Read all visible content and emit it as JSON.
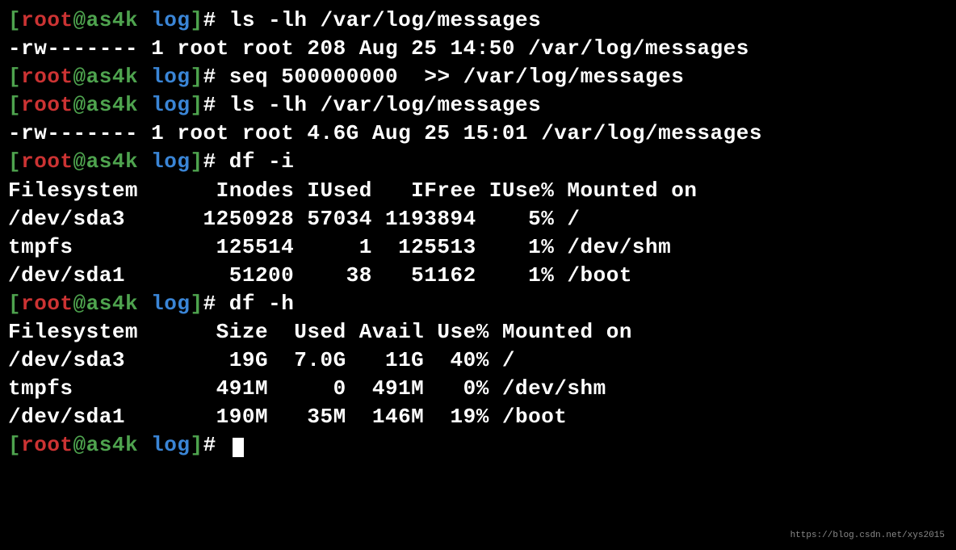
{
  "prompt": {
    "open": "[",
    "user": "root",
    "at": "@",
    "host": "as4k",
    "space": " ",
    "dir": "log",
    "close": "]",
    "hash": "#"
  },
  "lines": [
    {
      "type": "cmd",
      "text": "ls -lh /var/log/messages"
    },
    {
      "type": "out",
      "text": "-rw------- 1 root root 208 Aug 25 14:50 /var/log/messages"
    },
    {
      "type": "cmd",
      "text": "seq 500000000  >> /var/log/messages"
    },
    {
      "type": "cmd",
      "text": "ls -lh /var/log/messages"
    },
    {
      "type": "out",
      "text": "-rw------- 1 root root 4.6G Aug 25 15:01 /var/log/messages"
    },
    {
      "type": "cmd",
      "text": "df -i"
    },
    {
      "type": "out",
      "text": "Filesystem      Inodes IUsed   IFree IUse% Mounted on"
    },
    {
      "type": "out",
      "text": "/dev/sda3      1250928 57034 1193894    5% /"
    },
    {
      "type": "out",
      "text": "tmpfs           125514     1  125513    1% /dev/shm"
    },
    {
      "type": "out",
      "text": "/dev/sda1        51200    38   51162    1% /boot"
    },
    {
      "type": "cmd",
      "text": "df -h"
    },
    {
      "type": "out",
      "text": "Filesystem      Size  Used Avail Use% Mounted on"
    },
    {
      "type": "out",
      "text": "/dev/sda3        19G  7.0G   11G  40% /"
    },
    {
      "type": "out",
      "text": "tmpfs           491M     0  491M   0% /dev/shm"
    },
    {
      "type": "out",
      "text": "/dev/sda1       190M   35M  146M  19% /boot"
    },
    {
      "type": "cmd",
      "text": "",
      "cursor": true
    }
  ],
  "watermark": "https://blog.csdn.net/xys2015"
}
